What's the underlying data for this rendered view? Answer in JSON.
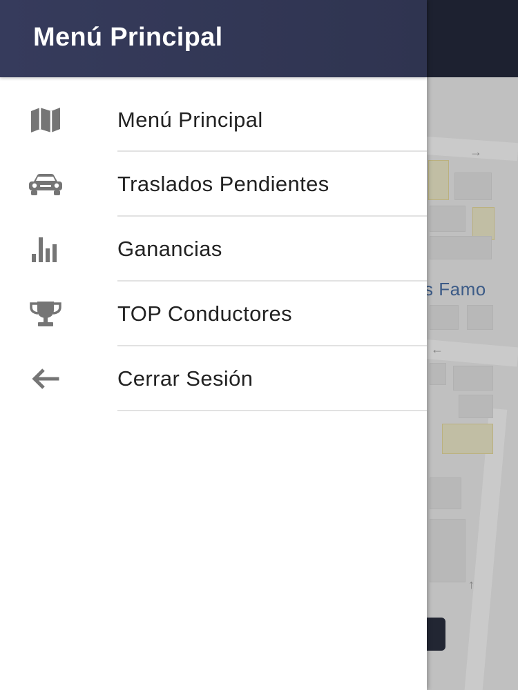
{
  "drawer": {
    "title": "Menú Principal",
    "items": [
      {
        "label": "Menú Principal",
        "icon": "map-icon"
      },
      {
        "label": "Traslados Pendientes",
        "icon": "car-icon"
      },
      {
        "label": "Ganancias",
        "icon": "bar-chart-icon"
      },
      {
        "label": "TOP Conductores",
        "icon": "trophy-icon"
      },
      {
        "label": "Cerrar Sesión",
        "icon": "arrow-left-icon"
      }
    ]
  },
  "map": {
    "partial_label": "s Famo"
  },
  "colors": {
    "drawer_header": "#34395a",
    "app_bar": "#24293b",
    "icon": "#757575",
    "text": "#222222",
    "divider": "#e2e2e2",
    "map_label": "#4a6fa5"
  }
}
